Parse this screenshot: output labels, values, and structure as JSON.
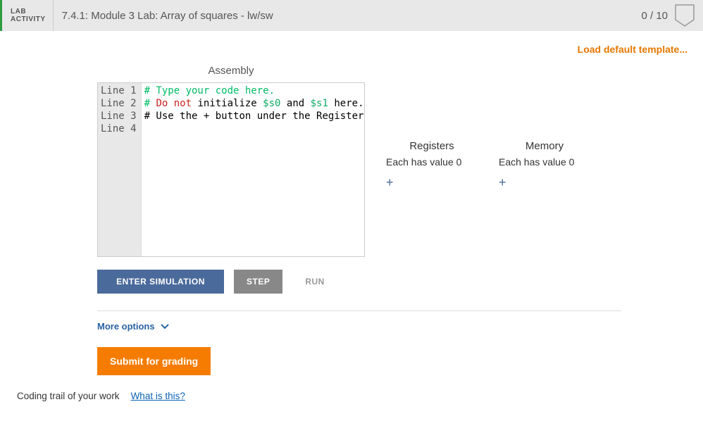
{
  "header": {
    "label_line1": "LAB",
    "label_line2": "ACTIVITY",
    "title": "7.4.1: Module 3 Lab: Array of squares - lw/sw",
    "score": "0 / 10"
  },
  "links": {
    "load_template": "Load default template..."
  },
  "editor": {
    "heading": "Assembly",
    "lines": [
      {
        "num": "Line 1",
        "segments": [
          {
            "cls": "cm-comment",
            "text": "# Type your code here."
          }
        ]
      },
      {
        "num": "Line 2",
        "segments": [
          {
            "cls": "cm-comment",
            "text": "# "
          },
          {
            "cls": "cm-kw",
            "text": "Do not"
          },
          {
            "cls": "cm-comment2",
            "text": " initialize "
          },
          {
            "cls": "cm-var",
            "text": "$s0"
          },
          {
            "cls": "cm-comment2",
            "text": " and "
          },
          {
            "cls": "cm-var",
            "text": "$s1"
          },
          {
            "cls": "cm-comment2",
            "text": " here."
          }
        ]
      },
      {
        "num": "Line 3",
        "segments": [
          {
            "cls": "cm-comment2",
            "text": "# Use the + button under the Register di"
          }
        ]
      },
      {
        "num": "Line 4",
        "segments": []
      }
    ]
  },
  "panels": {
    "registers": {
      "title": "Registers",
      "sub": "Each has value 0",
      "plus": "+"
    },
    "memory": {
      "title": "Memory",
      "sub": "Each has value 0",
      "plus": "+"
    }
  },
  "buttons": {
    "enter_sim": "ENTER SIMULATION",
    "step": "STEP",
    "run": "RUN",
    "more_options": "More options",
    "submit": "Submit for grading"
  },
  "footer": {
    "coding_trail": "Coding trail of your work",
    "what_is_this": "What is this?"
  }
}
